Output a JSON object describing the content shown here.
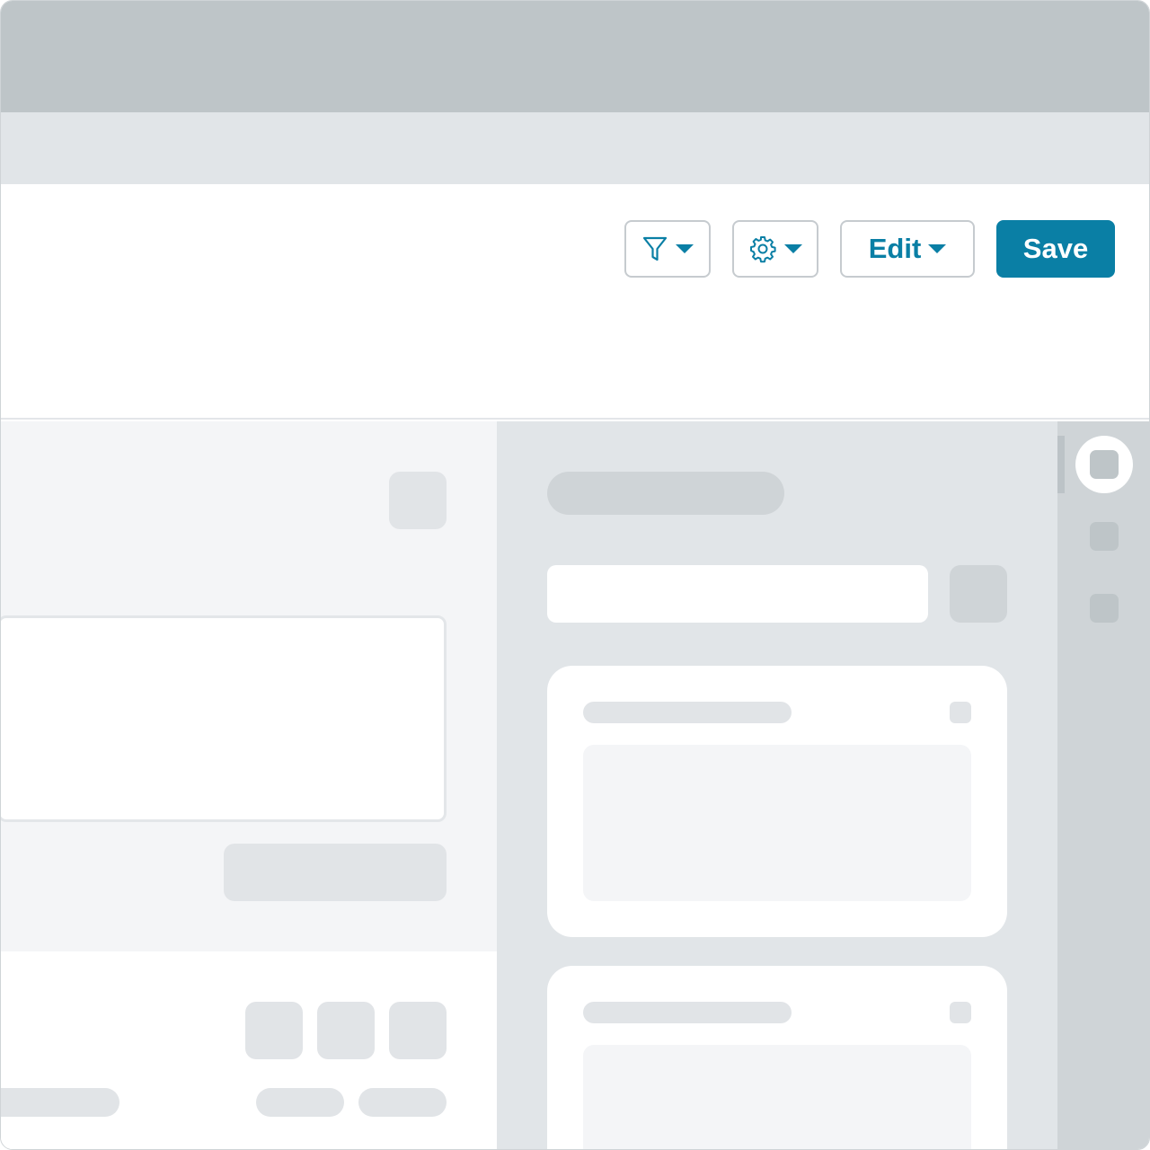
{
  "toolbar": {
    "filter_icon": "filter-icon",
    "settings_icon": "gear-icon",
    "edit_label": "Edit",
    "save_label": "Save"
  },
  "colors": {
    "accent": "#0a7fa5",
    "titlebar": "#bec5c8",
    "panel": "#e1e5e8",
    "rail": "#cfd4d7"
  }
}
